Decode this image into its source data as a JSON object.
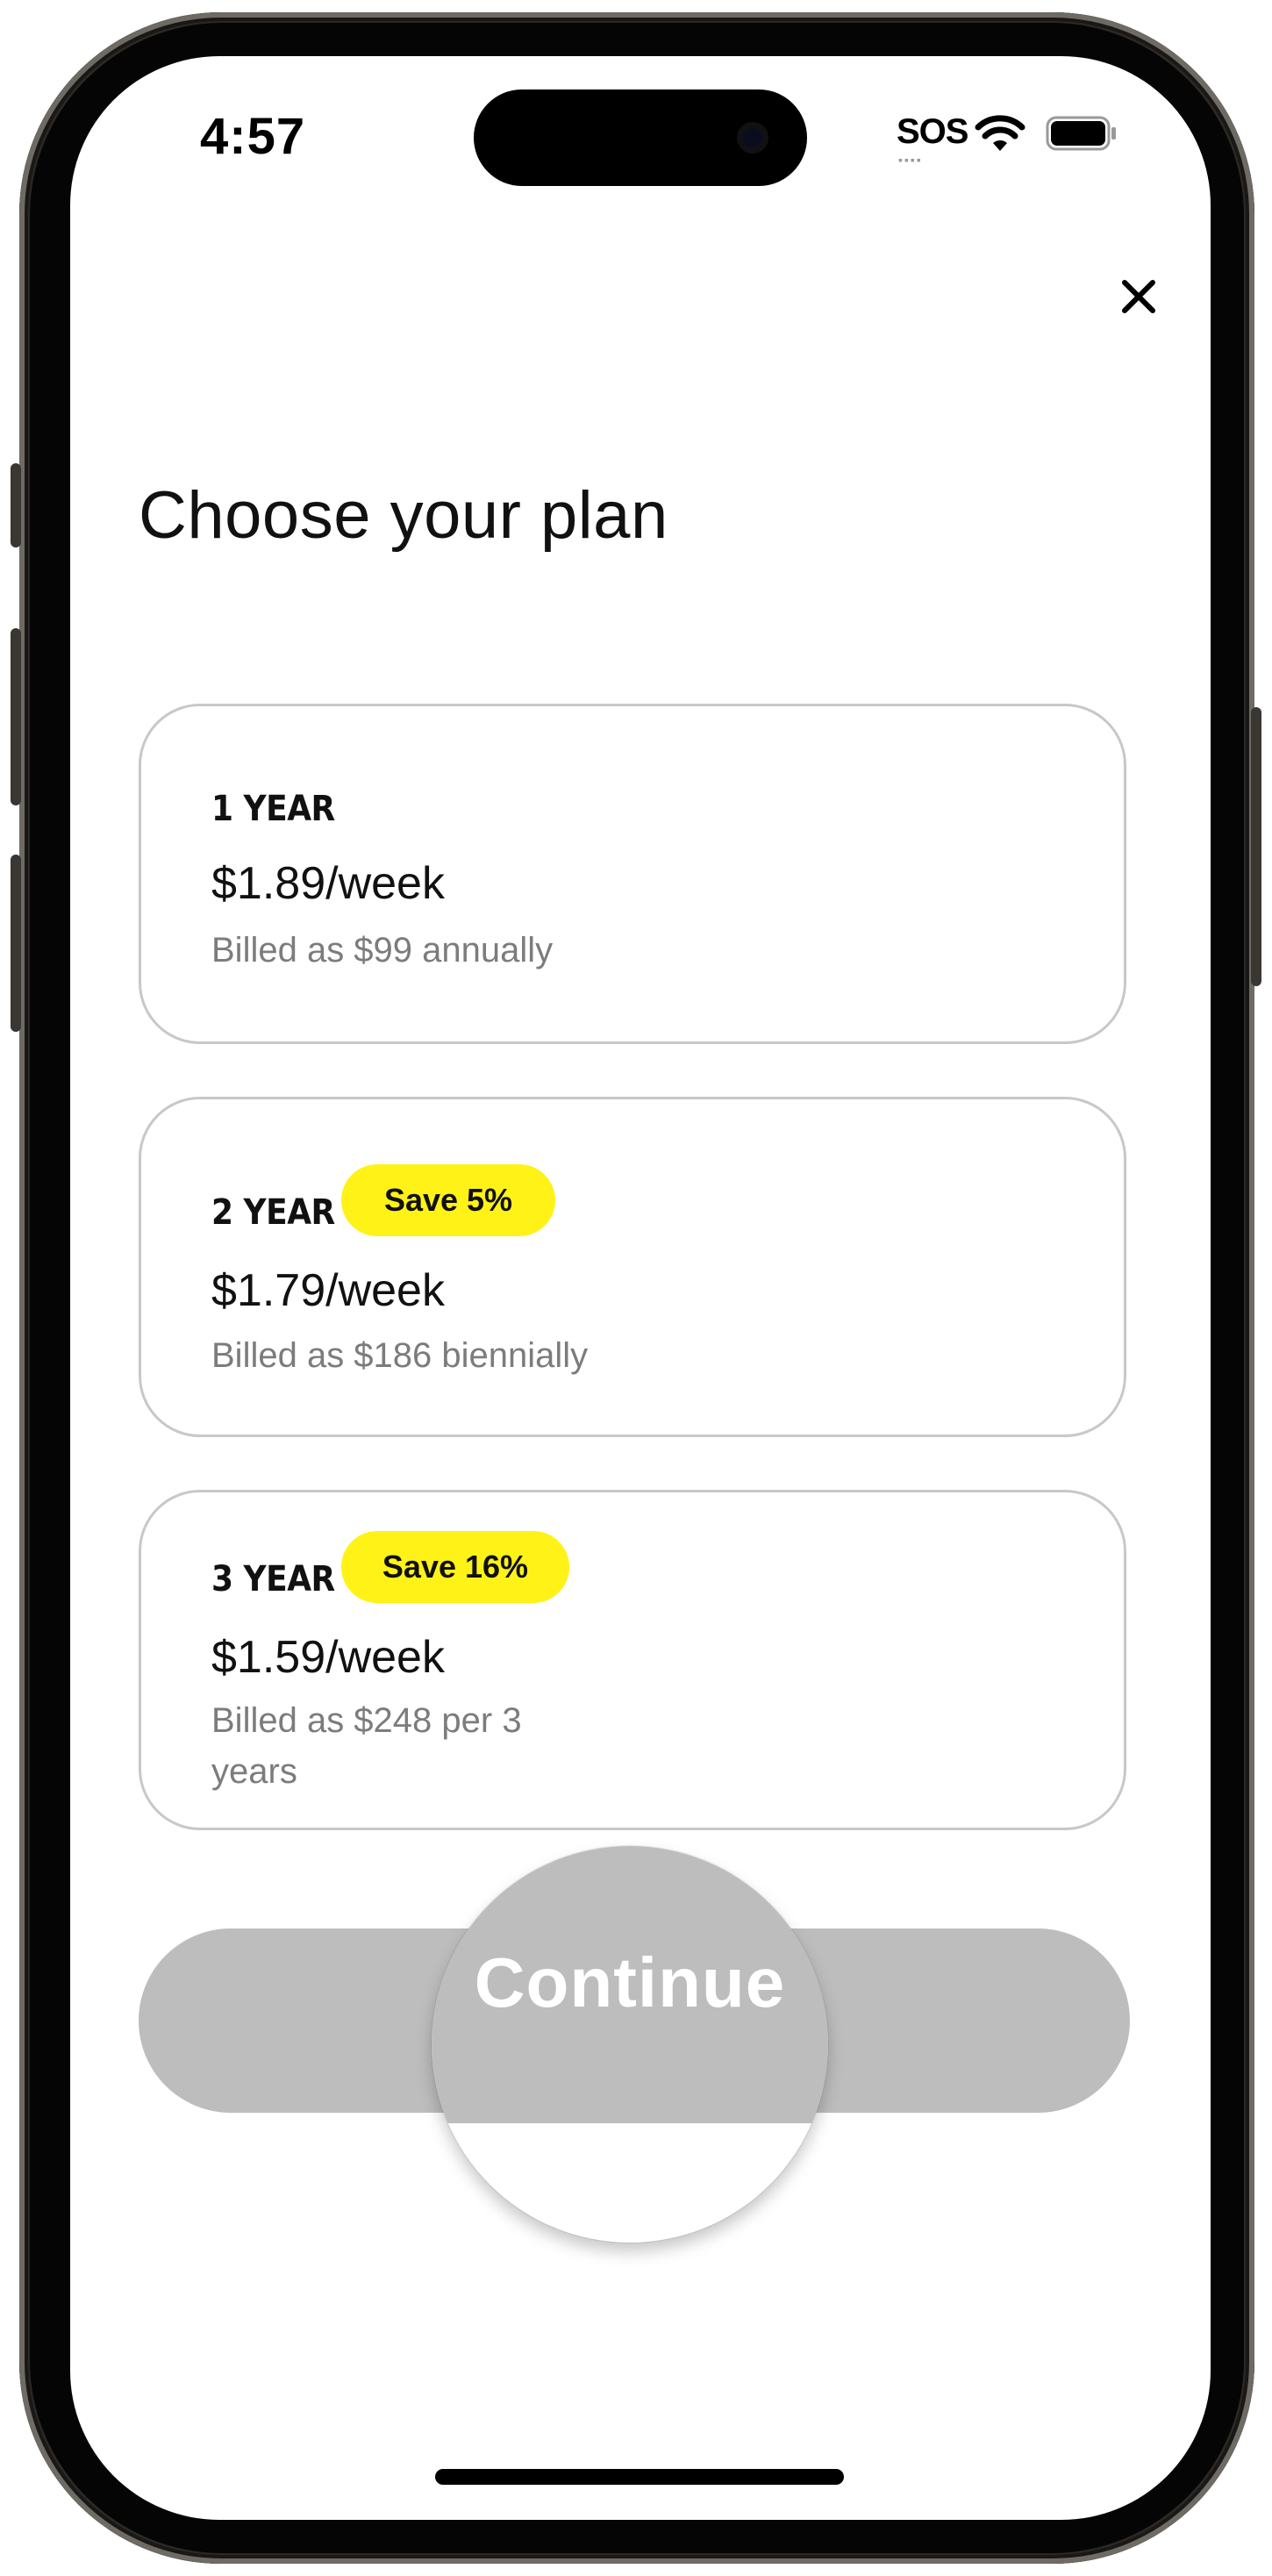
{
  "status_bar": {
    "time": "4:57",
    "carrier": "SOS",
    "icons": [
      "wifi-icon",
      "battery-icon"
    ]
  },
  "header": {
    "close_icon": "close-icon",
    "title": "Choose your plan"
  },
  "plans": [
    {
      "name": "1 YEAR",
      "badge": "",
      "price": "$1.89/week",
      "billing": "Billed as $99 annually"
    },
    {
      "name": "2 YEAR",
      "badge": "Save 5%",
      "price": "$1.79/week",
      "billing": "Billed as $186 biennially"
    },
    {
      "name": "3 YEAR",
      "badge": "Save 16%",
      "price": "$1.59/week",
      "billing_line1": "Billed as $248 per 3",
      "billing_line2": "years"
    }
  ],
  "continue": {
    "label": "Continue"
  },
  "colors": {
    "badge": "#fff217",
    "button_disabled": "#bdbdbd",
    "card_border": "#c8c8c8",
    "secondary_text": "#7c7c7c"
  }
}
